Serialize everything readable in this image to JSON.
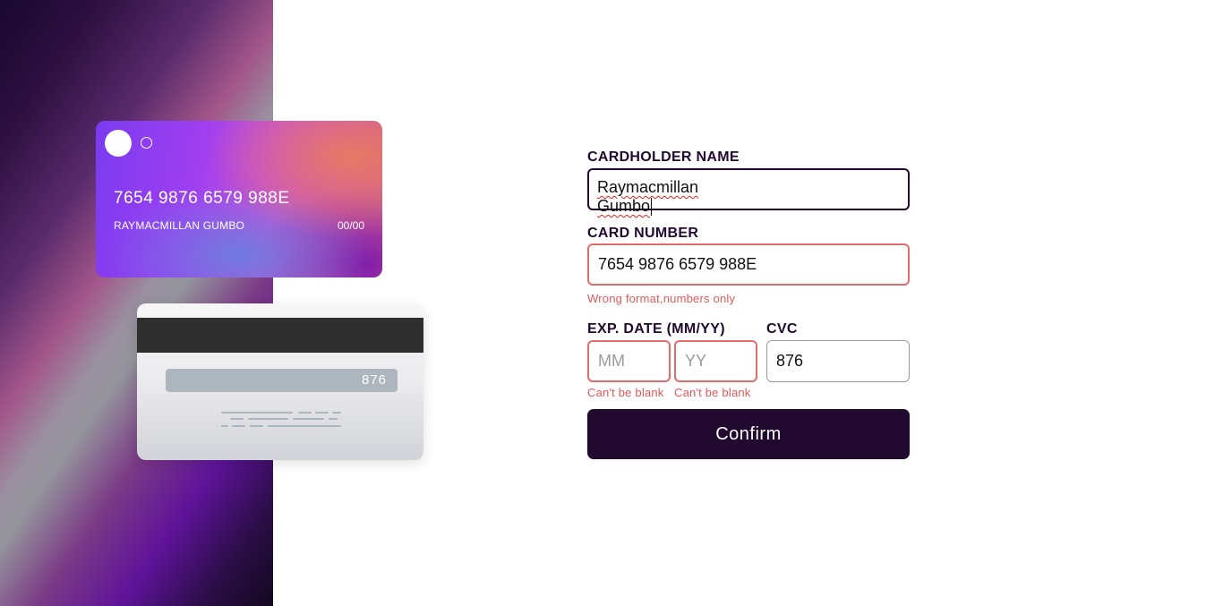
{
  "colors": {
    "accent": "#21092f",
    "error": "#e05a5a",
    "card_stripe": "#2e2e2e"
  },
  "card_front": {
    "number": "7654 9876 6579 988E",
    "holder": "RAYMACMILLAN GUMBO",
    "expiry": "00/00"
  },
  "card_back": {
    "cvc": "876"
  },
  "form": {
    "name_label": "CARDHOLDER NAME",
    "name_value": "Raymacmillan Gumbo",
    "number_label": "CARD NUMBER",
    "number_value": "7654 9876 6579 988E",
    "number_error": "Wrong format,numbers only",
    "exp_label": "EXP. DATE (MM/YY)",
    "mm_placeholder": "MM",
    "yy_placeholder": "YY",
    "mm_error": "Can't be blank",
    "yy_error": "Can't be blank",
    "cvc_label": "CVC",
    "cvc_value": "876",
    "confirm_label": "Confirm"
  }
}
